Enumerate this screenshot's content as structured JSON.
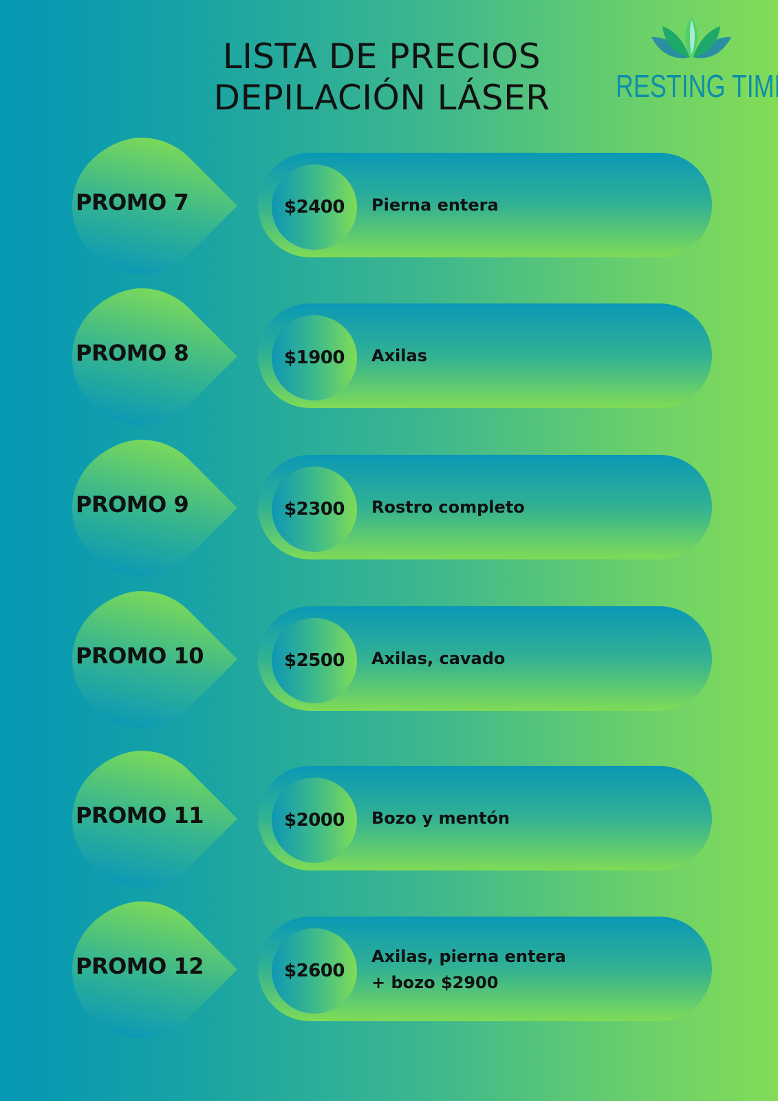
{
  "header": {
    "title_line1": "LISTA DE PRECIOS",
    "title_line2": "DEPILACIÓN LÁSER"
  },
  "logo": {
    "text": "RESTING TIME",
    "icon": "lotus-leaves-icon",
    "colors": [
      "#2a8fa0",
      "#1ea86a",
      "#4fd06a",
      "#a8ecd8"
    ]
  },
  "promos": [
    {
      "label": "PROMO 7",
      "price": "$2400",
      "desc": [
        "Pierna entera"
      ]
    },
    {
      "label": "PROMO 8",
      "price": "$1900",
      "desc": [
        "Axilas"
      ]
    },
    {
      "label": "PROMO 9",
      "price": "$2300",
      "desc": [
        "Rostro completo"
      ]
    },
    {
      "label": "PROMO 10",
      "price": "$2500",
      "desc": [
        "Axilas, cavado"
      ]
    },
    {
      "label": "PROMO 11",
      "price": "$2000",
      "desc": [
        "Bozo y mentón"
      ]
    },
    {
      "label": "PROMO 12",
      "price": "$2600",
      "desc": [
        "Axilas, pierna entera",
        "+ bozo $2900"
      ]
    }
  ],
  "colors": {
    "background_left": "#0497b6",
    "background_right": "#82dc58",
    "text": "#111111",
    "logo_text": "#0f8ea9"
  }
}
